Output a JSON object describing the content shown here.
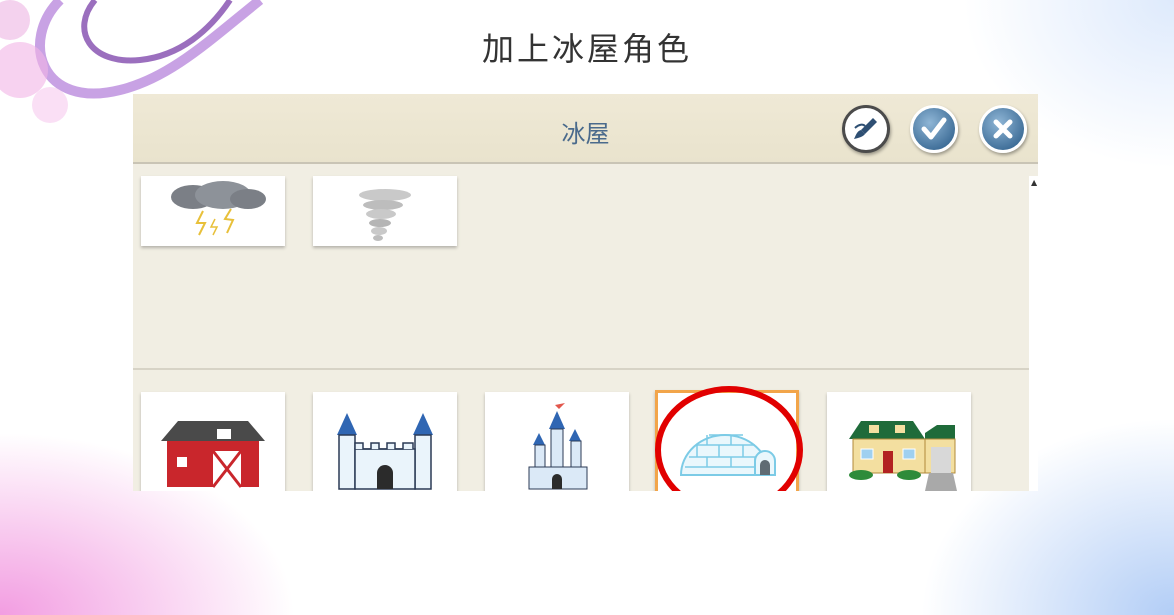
{
  "slide": {
    "title": "加上冰屋角色"
  },
  "app": {
    "header_title": "冰屋",
    "buttons": [
      {
        "name": "paint-button",
        "icon": "paintbrush-icon"
      },
      {
        "name": "confirm-button",
        "icon": "checkmark-icon"
      },
      {
        "name": "close-button",
        "icon": "close-icon"
      }
    ],
    "top_row_items": [
      {
        "icon": "storm-cloud-icon"
      },
      {
        "icon": "tornado-icon"
      }
    ],
    "bottom_row_items": [
      {
        "icon": "barn-icon"
      },
      {
        "icon": "castle-icon"
      },
      {
        "icon": "fairytale-castle-icon"
      },
      {
        "icon": "igloo-icon",
        "selected": true
      },
      {
        "icon": "house-icon"
      }
    ]
  },
  "colors": {
    "highlight": "#e10000",
    "selection_border": "#f2a54a",
    "header_text": "#4a6a8c",
    "button_blue": "#3f6e98"
  }
}
